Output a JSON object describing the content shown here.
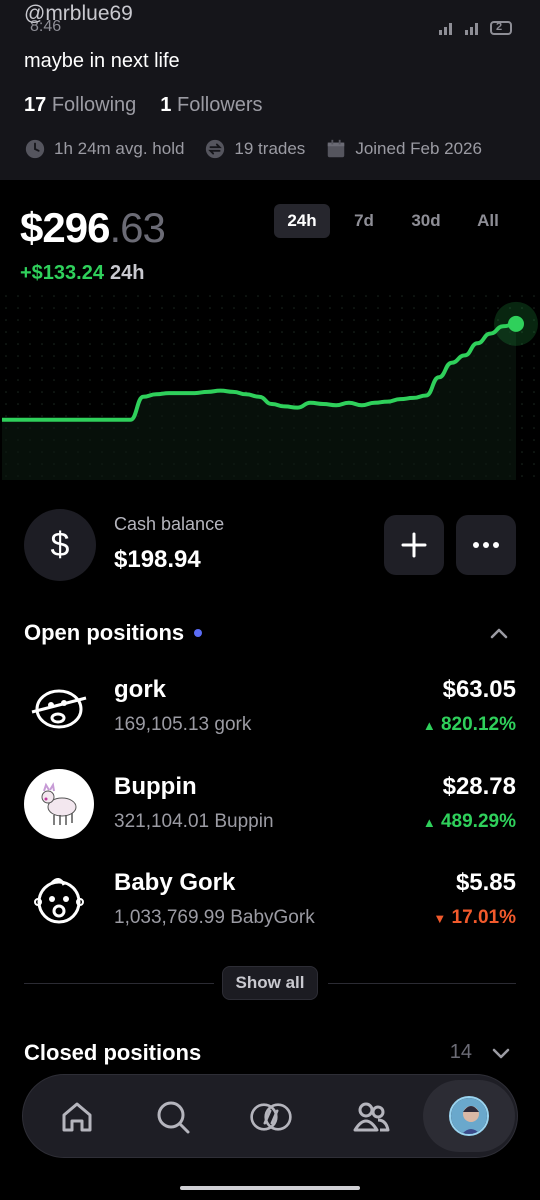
{
  "status": {
    "time": "8:46",
    "battery": "2"
  },
  "profile": {
    "username": "@mrblue69",
    "bio": "maybe in next life",
    "following_count": "17",
    "following_label": "Following",
    "followers_count": "1",
    "followers_label": "Followers",
    "avg_hold": "1h 24m avg. hold",
    "trades": "19 trades",
    "joined": "Joined Feb 2026"
  },
  "portfolio": {
    "value_whole": "$296",
    "value_cents": ".63",
    "change": "+$133.24",
    "change_period": "24h",
    "ranges": [
      "24h",
      "7d",
      "30d",
      "All"
    ],
    "selected_range": "24h"
  },
  "chart_data": {
    "type": "line",
    "x": [
      0,
      1,
      2,
      3,
      4,
      5,
      6,
      7,
      8,
      9,
      10,
      11,
      12,
      13,
      14,
      15,
      16,
      17,
      18,
      19,
      20,
      21,
      22,
      23,
      24,
      25,
      26,
      27,
      28,
      29,
      30,
      31,
      32,
      33,
      34,
      35,
      36,
      37,
      38,
      39,
      40
    ],
    "values": [
      163,
      163,
      163,
      163,
      163,
      163,
      163,
      163,
      163,
      163,
      163,
      182,
      184,
      185,
      185,
      185,
      186,
      187,
      186,
      184,
      182,
      176,
      174,
      173,
      177,
      176,
      175,
      177,
      175,
      177,
      178,
      180,
      181,
      183,
      198,
      210,
      216,
      226,
      234,
      240,
      242
    ],
    "color": "#2fd05b",
    "grid": "dotted"
  },
  "cash": {
    "label": "Cash balance",
    "value": "$198.94",
    "icon": "dollar-icon"
  },
  "open_positions": {
    "title": "Open positions",
    "items": [
      {
        "name": "gork",
        "qty": "169,105.13 gork",
        "value": "$63.05",
        "pct": "820.12%",
        "direction": "up"
      },
      {
        "name": "Buppin",
        "qty": "321,104.01 Buppin",
        "value": "$28.78",
        "pct": "489.29%",
        "direction": "up"
      },
      {
        "name": "Baby Gork",
        "qty": "1,033,769.99 BabyGork",
        "value": "$5.85",
        "pct": "17.01%",
        "direction": "down"
      }
    ],
    "show_all": "Show all"
  },
  "closed_positions": {
    "title": "Closed positions",
    "count": "14"
  },
  "nav": {
    "items": [
      "home-icon",
      "search-icon",
      "trade-icon",
      "users-icon",
      "profile-avatar"
    ]
  }
}
